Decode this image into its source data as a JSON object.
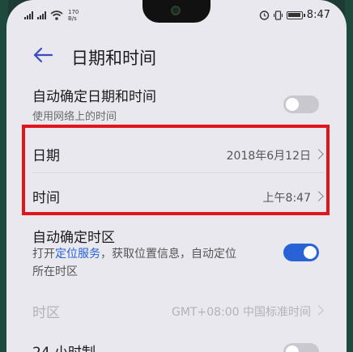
{
  "status_bar": {
    "speed_value": "170",
    "speed_unit": "B/s",
    "time": "8:47"
  },
  "header": {
    "title": "日期和时间",
    "back_icon": "arrow-left-icon"
  },
  "auto_datetime": {
    "label": "自动确定日期和时间",
    "subtitle": "使用网络上的时间",
    "enabled": false
  },
  "date_row": {
    "label": "日期",
    "value": "2018年6月12日"
  },
  "time_row": {
    "label": "时间",
    "value": "上午8:47"
  },
  "auto_timezone": {
    "label": "自动确定时区",
    "desc_prefix": "打开",
    "desc_link": "定位服务",
    "desc_suffix": "，获取位置信息，自动定位",
    "desc_line2": "所在时区",
    "enabled": true
  },
  "timezone_row": {
    "label": "时区",
    "value": "GMT+08:00 中国标准时间"
  },
  "hour24_row": {
    "label": "24 小时制"
  },
  "colors": {
    "accent": "#2862d6",
    "highlight_box": "#e0161c"
  }
}
